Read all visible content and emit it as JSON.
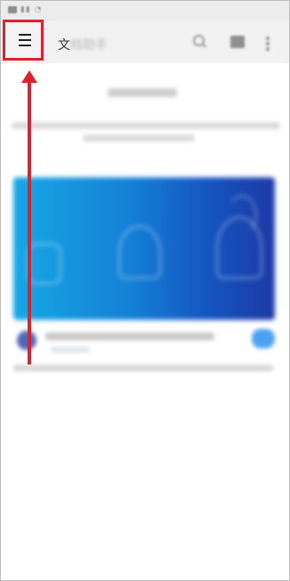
{
  "status_bar": {
    "icons": [
      "sim-icon",
      "signal-icon",
      "wifi-icon"
    ]
  },
  "header": {
    "title_visible_char": "文",
    "title_rest": "档助手",
    "menu_icon": "hamburger-menu-icon",
    "search_icon": "search-icon",
    "grid_icon": "grid-icon",
    "more_icon": "more-vertical-icon"
  },
  "annotation": {
    "highlight_color": "#d9232e",
    "arrow_color": "#d9232e"
  },
  "colors": {
    "banner_start": "#17a7e4",
    "banner_end": "#1c3aa6",
    "header_bg": "#f1f1f1",
    "status_bg": "#ececec"
  }
}
